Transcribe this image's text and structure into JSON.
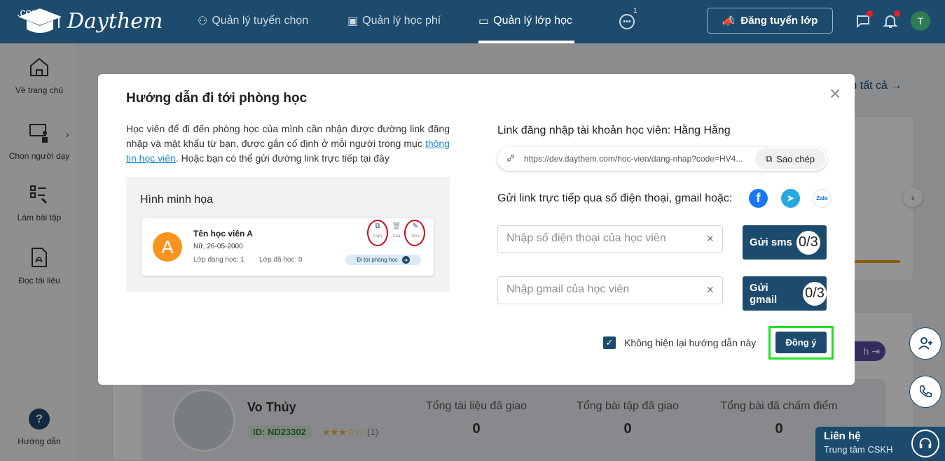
{
  "brand": {
    "name": "Daythem",
    "domain": ".com"
  },
  "nav": {
    "items": [
      {
        "label": "Quản lý tuyển chọn"
      },
      {
        "label": "Quản lý học phí"
      },
      {
        "label": "Quản lý lớp học"
      }
    ],
    "more_badge": "1",
    "post_button": "Đăng tuyển lớp",
    "avatar_initial": "T"
  },
  "sidebar": {
    "items": [
      {
        "label": "Về trang chủ"
      },
      {
        "label": "Chọn người dạy"
      },
      {
        "label": "Làm bài tập"
      },
      {
        "label": "Đọc tài liệu"
      },
      {
        "label": "Hướng dẫn"
      }
    ]
  },
  "background": {
    "view_all": "m tất cả →",
    "teacher_name": "Vo Thủy",
    "teacher_id": "ID: ND23302",
    "rating_stars": "★★★☆☆",
    "rating_count": "(1)",
    "stats": [
      {
        "label": "Tổng tài liệu đã giao",
        "value": "0"
      },
      {
        "label": "Tổng bài tập đã giao",
        "value": "0"
      },
      {
        "label": "Tổng bài đã chấm điểm",
        "value": "0"
      }
    ],
    "purple_btn": "h"
  },
  "contact": {
    "title": "Liên hệ",
    "subtitle": "Trung tâm CSKH"
  },
  "modal": {
    "title": "Hướng dẫn đi tới phòng học",
    "intro_before": "Học viên để đi đến phòng học của mình cần nhận được đường link đăng nhập và mật khẩu từ bạn, được gắn cố định ở mỗi người trong mục ",
    "intro_link": "thông tin học viên",
    "intro_after": ". Hoặc bạn có thể gửi đường link trực tiếp tại đây",
    "illustration": {
      "title": "Hình minh họa",
      "avatar_letter": "A",
      "student_name": "Tên học viên A",
      "student_dob": "Nữ, 26-05-2000",
      "classes_current": "Lớp đang học: 1",
      "classes_done": "Lớp đã học: 0",
      "action_copy": "Copy",
      "action_delete": "Xóa",
      "action_edit": "Sửa",
      "go_button": "Đi tới phòng học"
    },
    "login_label": "Link đăng nhập tài khoản học viên: Hằng Hằng",
    "login_url": "https://dev.daythem.com/hoc-vien/dang-nhap?code=HV4...",
    "copy_button": "Sao chép",
    "send_label": "Gửi link trực tiếp qua số điện thoại, gmail hoặc:",
    "phone_placeholder": "Nhập số điện thoại của học viên",
    "gmail_placeholder": "Nhập gmail của học viên",
    "sms_button": "Gửi sms",
    "sms_count": "0/3",
    "gmail_button": "Gửi gmail",
    "gmail_count": "0/3",
    "dont_show": "Không hiện lại hướng dẫn này",
    "ok_button": "Đồng ý",
    "zalo": "Zalo"
  },
  "colors": {
    "primary": "#1d4b6e",
    "highlight": "#22e022",
    "ring": "#d0021b"
  }
}
